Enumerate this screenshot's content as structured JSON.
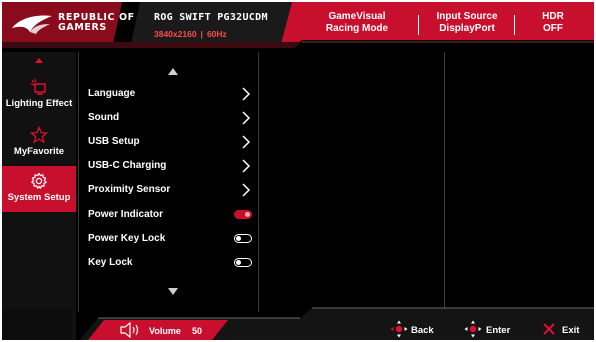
{
  "header": {
    "brand_line1": "REPUBLIC OF",
    "brand_line2": "GAMERS",
    "model": "ROG SWIFT PG32UCDM",
    "resolution": "3840x2160",
    "refresh": "60Hz",
    "gamevisual_line1": "GameVisual",
    "gamevisual_line2": "Racing Mode",
    "input_line1": "Input Source",
    "input_line2": "DisplayPort",
    "hdr_line1": "HDR",
    "hdr_line2": "OFF"
  },
  "sidebar": {
    "items": [
      {
        "label": "Lighting Effect",
        "icon": "lighting-effect-icon"
      },
      {
        "label": "MyFavorite",
        "icon": "star-icon"
      },
      {
        "label": "System Setup",
        "icon": "gear-icon",
        "active": true
      }
    ]
  },
  "menu": {
    "items": [
      {
        "label": "Language",
        "control": "chevron"
      },
      {
        "label": "Sound",
        "control": "chevron"
      },
      {
        "label": "USB Setup",
        "control": "chevron"
      },
      {
        "label": "USB-C Charging",
        "control": "chevron"
      },
      {
        "label": "Proximity Sensor",
        "control": "chevron"
      },
      {
        "label": "Power Indicator",
        "control": "toggle",
        "state": "on"
      },
      {
        "label": "Power Key Lock",
        "control": "toggle",
        "state": "off"
      },
      {
        "label": "Key Lock",
        "control": "toggle",
        "state": "off"
      }
    ]
  },
  "footer": {
    "volume_label": "Volume",
    "volume_value": "50",
    "back_label": "Back",
    "enter_label": "Enter",
    "exit_label": "Exit"
  },
  "colors": {
    "accent_red": "#c8102e",
    "background": "#000000",
    "text": "#ffffff"
  }
}
